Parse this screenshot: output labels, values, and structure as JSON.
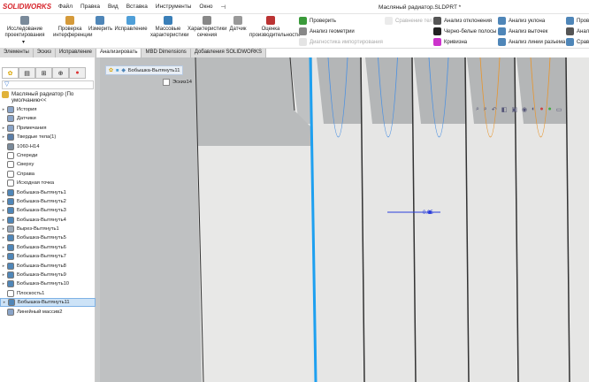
{
  "app": {
    "logo": "SOLIDWORKS",
    "menu": [
      "Файл",
      "Правка",
      "Вид",
      "Вставка",
      "Инструменты",
      "Окно"
    ],
    "pin": "⊣",
    "document_title": "Масляный радиатор.SLDPRT *"
  },
  "ribbon": {
    "large": [
      {
        "label": "Исследование проектирования",
        "name": "design-study"
      },
      {
        "label": "Проверка интерференции",
        "name": "interference-check"
      },
      {
        "label": "Измерить",
        "name": "measure"
      },
      {
        "label": "Исправление",
        "name": "repair"
      },
      {
        "label": "Массовые характеристики",
        "name": "mass-properties"
      },
      {
        "label": "Характеристики сечения",
        "name": "section-properties"
      },
      {
        "label": "Датчик",
        "name": "sensor"
      },
      {
        "label": "Оценка производительности",
        "name": "performance-evaluation"
      }
    ],
    "small": [
      {
        "label": "Проверить",
        "disabled": false
      },
      {
        "label": "Анализ геометрии",
        "disabled": false
      },
      {
        "label": "Диагностика импортирования",
        "disabled": true
      },
      {
        "label": "Сравнение тел",
        "disabled": true
      },
      {
        "label": "Анализ отклонения",
        "disabled": false
      },
      {
        "label": "Черно-белые полосы",
        "disabled": false
      },
      {
        "label": "Кривизна",
        "disabled": false
      },
      {
        "label": "Анализ уклона",
        "disabled": false
      },
      {
        "label": "Анализ выточек",
        "disabled": false
      },
      {
        "label": "Анализ линии разъема",
        "disabled": false
      },
      {
        "label": "Прове",
        "disabled": false
      },
      {
        "label": "Анал",
        "disabled": false
      },
      {
        "label": "Срав",
        "disabled": false
      }
    ]
  },
  "tabs": [
    "Элементы",
    "Эскиз",
    "Исправление",
    "Анализировать",
    "MBD Dimensions",
    "Добавления SOLIDWORKS"
  ],
  "active_tab": "Анализировать",
  "tree": {
    "root": "Масляный радиатор  (По умолчанию<<",
    "items": [
      {
        "label": "История",
        "arrow": true,
        "color": "#8aa4c8"
      },
      {
        "label": "Датчики",
        "arrow": false,
        "color": "#8aa4c8"
      },
      {
        "label": "Примечания",
        "arrow": true,
        "color": "#8aa4c8"
      },
      {
        "label": "Твердые тела(1)",
        "arrow": true,
        "color": "#5a7ea8"
      },
      {
        "label": "1060-H14",
        "arrow": false,
        "color": "#7a8a9a"
      },
      {
        "label": "Спереди",
        "arrow": false,
        "color": "#fff"
      },
      {
        "label": "Сверху",
        "arrow": false,
        "color": "#fff"
      },
      {
        "label": "Справа",
        "arrow": false,
        "color": "#fff"
      },
      {
        "label": "Исходная точка",
        "arrow": false,
        "color": "#fff"
      },
      {
        "label": "Бобышка-Вытянуть1",
        "arrow": true,
        "color": "#4f86b8"
      },
      {
        "label": "Бобышка-Вытянуть2",
        "arrow": true,
        "color": "#4f86b8"
      },
      {
        "label": "Бобышка-Вытянуть3",
        "arrow": true,
        "color": "#4f86b8"
      },
      {
        "label": "Бобышка-Вытянуть4",
        "arrow": true,
        "color": "#4f86b8"
      },
      {
        "label": "Вырез-Вытянуть1",
        "arrow": true,
        "color": "#9aa8b8"
      },
      {
        "label": "Бобышка-Вытянуть5",
        "arrow": true,
        "color": "#4f86b8"
      },
      {
        "label": "Бобышка-Вытянуть6",
        "arrow": true,
        "color": "#4f86b8"
      },
      {
        "label": "Бобышка-Вытянуть7",
        "arrow": true,
        "color": "#4f86b8"
      },
      {
        "label": "Бобышка-Вытянуть8",
        "arrow": true,
        "color": "#4f86b8"
      },
      {
        "label": "Бобышка-Вытянуть9",
        "arrow": true,
        "color": "#4f86b8"
      },
      {
        "label": "Бобышка-Вытянуть10",
        "arrow": true,
        "color": "#4f86b8"
      },
      {
        "label": "Плоскость1",
        "arrow": false,
        "color": "#fff"
      },
      {
        "label": "Бобышка-Вытянуть11",
        "arrow": true,
        "color": "#4f86b8",
        "selected": true
      },
      {
        "label": "Линейный массив2",
        "arrow": false,
        "color": "#8aa4c8"
      }
    ]
  },
  "viewport": {
    "breadcrumb": "Бобышка-Вытянуть11",
    "sketch": "Эскиз14",
    "dimension": "0.05"
  }
}
